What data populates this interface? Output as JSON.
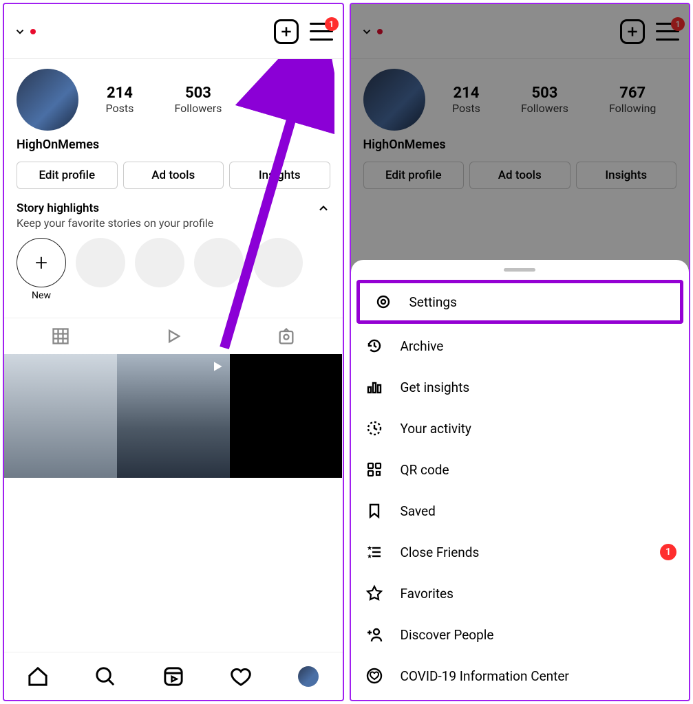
{
  "profile": {
    "display_name": "HighOnMemes",
    "stats": [
      {
        "num": "214",
        "label": "Posts"
      },
      {
        "num": "503",
        "label": "Followers"
      },
      {
        "num": "767",
        "label": "Following"
      }
    ]
  },
  "buttons": {
    "edit_profile": "Edit profile",
    "ad_tools": "Ad tools",
    "insights": "Insights"
  },
  "highlights": {
    "title": "Story highlights",
    "subtitle": "Keep your favorite stories on your profile",
    "new_label": "New"
  },
  "hamburger_badge": "1",
  "menu": {
    "items": [
      {
        "icon": "gear-icon",
        "label": "Settings",
        "highlight": true
      },
      {
        "icon": "history-icon",
        "label": "Archive"
      },
      {
        "icon": "chart-icon",
        "label": "Get insights"
      },
      {
        "icon": "activity-icon",
        "label": "Your activity"
      },
      {
        "icon": "qr-icon",
        "label": "QR code"
      },
      {
        "icon": "bookmark-icon",
        "label": "Saved"
      },
      {
        "icon": "list-star-icon",
        "label": "Close Friends",
        "badge": "1"
      },
      {
        "icon": "star-icon",
        "label": "Favorites"
      },
      {
        "icon": "add-person-icon",
        "label": "Discover People"
      },
      {
        "icon": "heart-circle-icon",
        "label": "COVID-19 Information Center"
      }
    ]
  },
  "icons": {
    "gear-icon": "<circle cx='14' cy='14' r='8' fill='none' stroke='#000' stroke-width='2.4'/><circle cx='14' cy='14' r='3' fill='none' stroke='#000' stroke-width='2.4'/>",
    "history-icon": "<path d='M6 14a8 8 0 1 1 2.3 5.6' fill='none' stroke='#000' stroke-width='2.4'/><polyline points='6,10 6,14 10,14' fill='none' stroke='#000' stroke-width='2.4'/><polyline points='14,9 14,14 17,16' fill='none' stroke='#000' stroke-width='2.4'/>",
    "chart-icon": "<rect x='5' y='14' width='4' height='8' fill='none' stroke='#000' stroke-width='2.4'/><rect x='12' y='8' width='4' height='14' fill='none' stroke='#000' stroke-width='2.4'/><rect x='19' y='11' width='4' height='11' fill='none' stroke='#000' stroke-width='2.4'/>",
    "activity-icon": "<circle cx='14' cy='14' r='9' fill='none' stroke='#000' stroke-width='2.4' stroke-dasharray='3 3'/><polyline points='14,9 14,14 18,16' fill='none' stroke='#000' stroke-width='2.4'/>",
    "qr-icon": "<rect x='5' y='5' width='7' height='7' rx='1' fill='none' stroke='#000' stroke-width='2.2'/><rect x='16' y='5' width='7' height='7' rx='1' fill='none' stroke='#000' stroke-width='2.2'/><rect x='5' y='16' width='7' height='7' rx='1' fill='none' stroke='#000' stroke-width='2.2'/><rect x='17' y='17' width='5' height='5' fill='none' stroke='#000' stroke-width='2.2'/>",
    "bookmark-icon": "<path d='M8 5h12v18l-6-5-6 5z' fill='none' stroke='#000' stroke-width='2.4'/>",
    "list-star-icon": "<line x1='11' y1='8' x2='23' y2='8' stroke='#000' stroke-width='2.4'/><line x1='11' y1='14' x2='23' y2='14' stroke='#000' stroke-width='2.4'/><line x1='11' y1='20' x2='23' y2='20' stroke='#000' stroke-width='2.4'/><text x='3' y='11' font-size='9'>★</text><text x='3' y='23' font-size='9'>★</text>",
    "star-icon": "<path d='M14 4l3 6 7 1-5 5 1 7-6-3-6 3 1-7-5-5 7-1z' fill='none' stroke='#000' stroke-width='2.2'/>",
    "add-person-icon": "<circle cx='17' cy='10' r='4' fill='none' stroke='#000' stroke-width='2.4'/><path d='M10 24c0-4 3-6 7-6s7 2 7 6' fill='none' stroke='#000' stroke-width='2.4'/><line x1='4' y1='11' x2='10' y2='11' stroke='#000' stroke-width='2.4'/><line x1='7' y1='8' x2='7' y2='14' stroke='#000' stroke-width='2.4'/>",
    "heart-circle-icon": "<circle cx='14' cy='14' r='10' fill='none' stroke='#000' stroke-width='2.4'/><path d='M14 19c-3-2-6-4-6-7a3 3 0 0 1 6-1 3 3 0 0 1 6 1c0 3-3 5-6 7z' fill='none' stroke='#000' stroke-width='2'/>"
  }
}
